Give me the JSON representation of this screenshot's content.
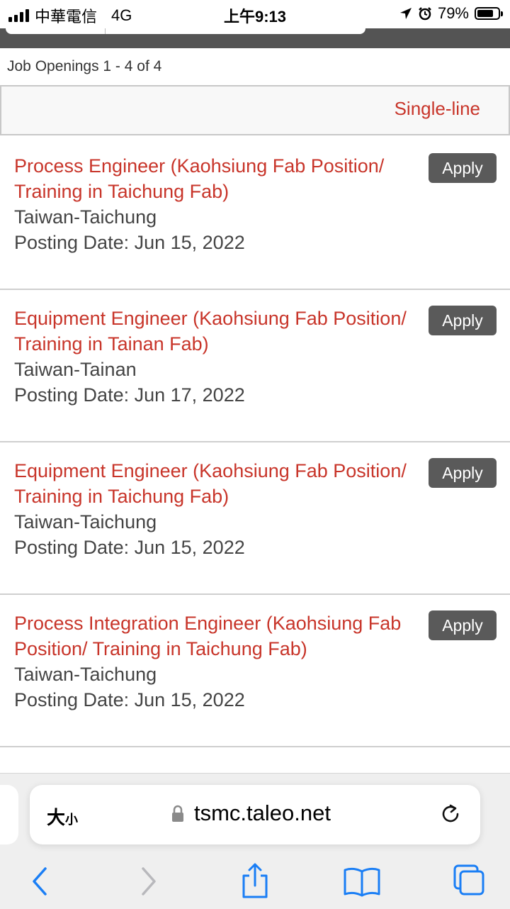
{
  "status_bar": {
    "carrier": "中華電信",
    "network": "4G",
    "time": "上午9:13",
    "battery": "79%",
    "battery_level": 0.79
  },
  "job_count": "Job Openings 1 - 4 of 4",
  "view_toggle": "Single-line",
  "jobs": [
    {
      "title": "Process Engineer (Kaohsiung Fab Position/ Training in Taichung Fab)",
      "location": "Taiwan-Taichung",
      "posting_date": "Posting Date: Jun 15, 2022",
      "apply_label": "Apply"
    },
    {
      "title": "Equipment Engineer (Kaohsiung Fab Position/ Training in Tainan Fab)",
      "location": "Taiwan-Tainan",
      "posting_date": "Posting Date: Jun 17, 2022",
      "apply_label": "Apply"
    },
    {
      "title": "Equipment Engineer (Kaohsiung Fab Position/ Training in Taichung Fab)",
      "location": "Taiwan-Taichung",
      "posting_date": "Posting Date: Jun 15, 2022",
      "apply_label": "Apply"
    },
    {
      "title": "Process Integration Engineer (Kaohsiung Fab Position/ Training in Taichung Fab)",
      "location": "Taiwan-Taichung",
      "posting_date": "Posting Date: Jun 15, 2022",
      "apply_label": "Apply"
    }
  ],
  "browser": {
    "text_size_big": "大",
    "text_size_small": "小",
    "url": "tsmc.taleo.net"
  },
  "colors": {
    "link_red": "#c8352a",
    "button_gray": "#5a5a5a",
    "ios_blue": "#1a7ef5"
  },
  "icons": [
    "signal-icon",
    "location-arrow-icon",
    "alarm-icon",
    "battery-icon",
    "lock-icon",
    "reload-icon",
    "back-icon",
    "forward-icon",
    "share-icon",
    "bookmarks-icon",
    "tabs-icon"
  ]
}
